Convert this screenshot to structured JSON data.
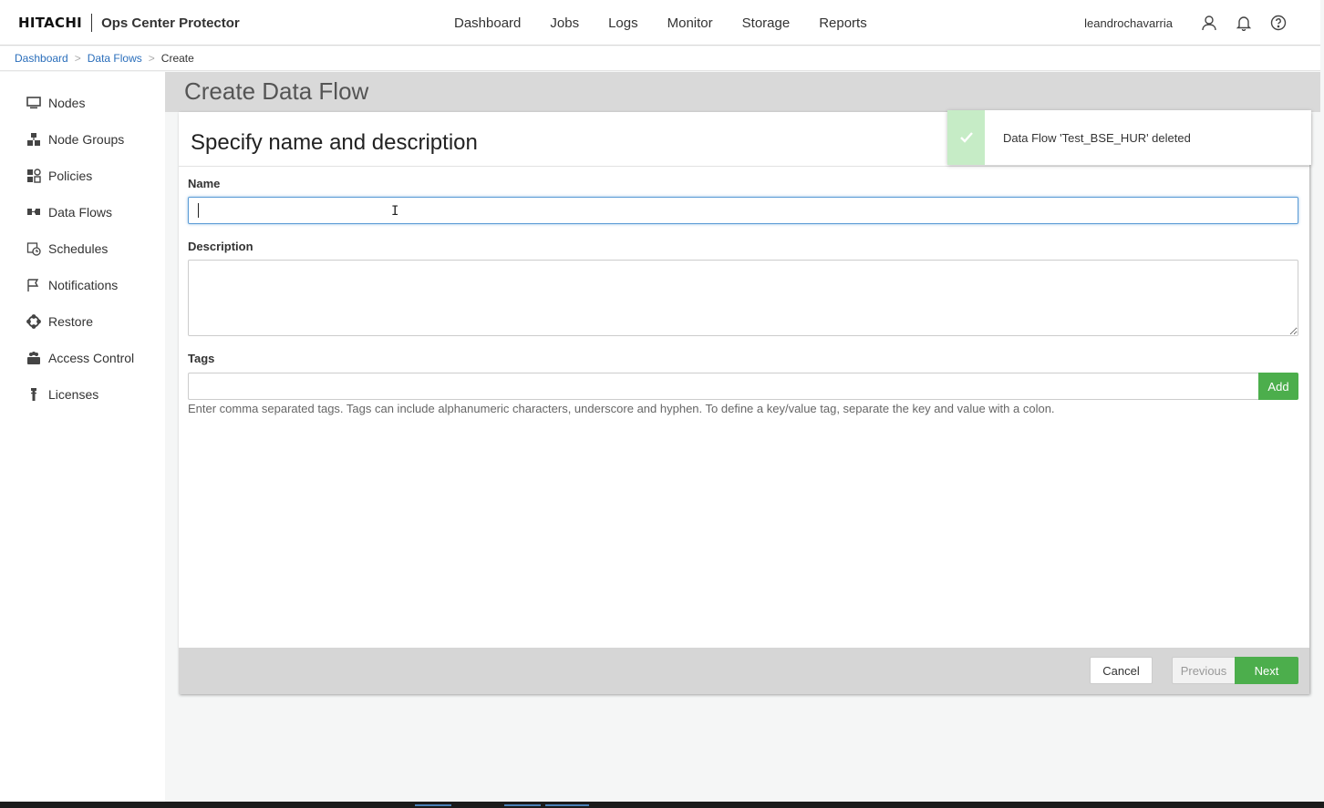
{
  "header": {
    "logo": "HITACHI",
    "product": "Ops Center Protector",
    "nav": [
      "Dashboard",
      "Jobs",
      "Logs",
      "Monitor",
      "Storage",
      "Reports"
    ],
    "username": "leandrochavarria"
  },
  "breadcrumb": {
    "items": [
      "Dashboard",
      "Data Flows"
    ],
    "current": "Create",
    "separator": ">"
  },
  "sidebar": {
    "items": [
      {
        "label": "Nodes",
        "icon": "monitor-icon"
      },
      {
        "label": "Node Groups",
        "icon": "node-groups-icon"
      },
      {
        "label": "Policies",
        "icon": "policies-icon"
      },
      {
        "label": "Data Flows",
        "icon": "data-flows-icon"
      },
      {
        "label": "Schedules",
        "icon": "schedules-icon"
      },
      {
        "label": "Notifications",
        "icon": "flag-icon"
      },
      {
        "label": "Restore",
        "icon": "restore-icon"
      },
      {
        "label": "Access Control",
        "icon": "access-control-icon"
      },
      {
        "label": "Licenses",
        "icon": "license-icon"
      }
    ]
  },
  "page": {
    "title": "Create Data Flow",
    "section_title": "Specify name and description"
  },
  "form": {
    "name_label": "Name",
    "name_value": "",
    "description_label": "Description",
    "description_value": "",
    "tags_label": "Tags",
    "tags_value": "",
    "add_label": "Add",
    "tags_help": "Enter comma separated tags. Tags can include alphanumeric characters, underscore and hyphen. To define a key/value tag, separate the key and value with a colon."
  },
  "footer": {
    "cancel": "Cancel",
    "previous": "Previous",
    "next": "Next"
  },
  "toast": {
    "message": "Data Flow 'Test_BSE_HUR' deleted",
    "icon": "check-icon"
  },
  "colors": {
    "link": "#2a6ebb",
    "primary_green": "#4cae4c",
    "toast_green": "#c6ecc6",
    "title_bar": "#d9d9d9"
  }
}
